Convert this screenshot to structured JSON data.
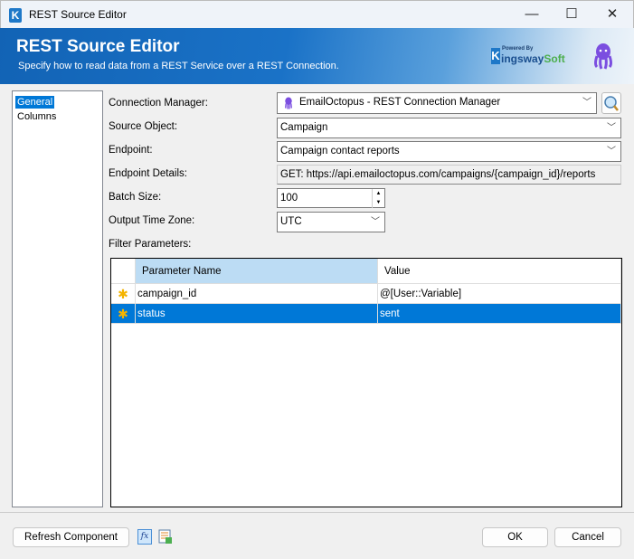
{
  "window": {
    "title": "REST Source Editor",
    "app_icon": "K"
  },
  "banner": {
    "title": "REST Source Editor",
    "subtitle": "Specify how to read data from a REST Service over a REST Connection.",
    "logo_powered_by": "Powered By",
    "logo_k": "K",
    "logo_name": "ingsway",
    "logo_soft": "Soft"
  },
  "sidebar": {
    "items": [
      {
        "label": "General",
        "selected": true
      },
      {
        "label": "Columns"
      }
    ]
  },
  "form": {
    "connection_manager_label": "Connection Manager:",
    "connection_manager_value": "EmailOctopus - REST Connection Manager",
    "source_object_label": "Source Object:",
    "source_object_value": "Campaign",
    "endpoint_label": "Endpoint:",
    "endpoint_value": "Campaign contact reports",
    "endpoint_details_label": "Endpoint Details:",
    "endpoint_details_value": "GET: https://api.emailoctopus.com/campaigns/{campaign_id}/reports",
    "batch_size_label": "Batch Size:",
    "batch_size_value": "100",
    "time_zone_label": "Output Time Zone:",
    "time_zone_value": "UTC",
    "filter_label": "Filter Parameters:"
  },
  "grid": {
    "columns": [
      "Parameter Name",
      "Value"
    ],
    "rows": [
      {
        "marker": "✱",
        "name": "campaign_id",
        "value": "@[User::Variable]"
      },
      {
        "marker": "✱",
        "name": "status",
        "value": "sent",
        "selected": true
      }
    ]
  },
  "footer": {
    "refresh": "Refresh Component",
    "fx": "fx",
    "ok": "OK",
    "cancel": "Cancel"
  },
  "colors": {
    "accent": "#0078d7",
    "banner": "#1263b5",
    "star": "#f4b400"
  }
}
